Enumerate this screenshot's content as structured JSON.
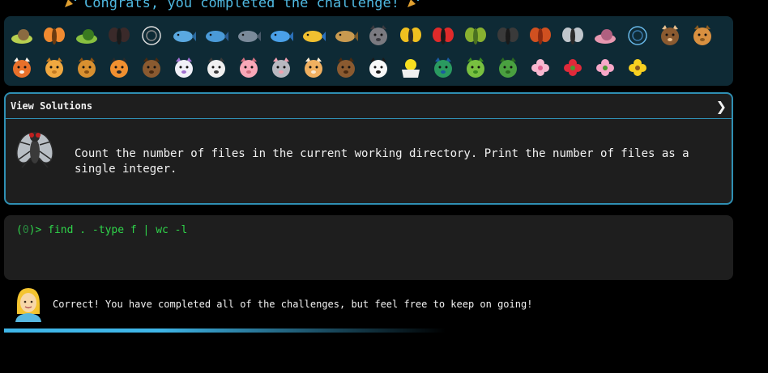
{
  "banner": {
    "text": "Congrats, you completed the challenge!",
    "icon_left": "party-popper-icon",
    "icon_right": "party-popper-icon"
  },
  "creatures": {
    "row1": [
      "snail",
      "butterfly",
      "caterpillar",
      "ant",
      "spider-web",
      "whale",
      "dolphin",
      "shark",
      "fish",
      "tropical-fish",
      "blowfish",
      "wolf",
      "bee",
      "ladybug",
      "cricket",
      "spider",
      "scorpion",
      "fly",
      "worm",
      "microbe",
      "monkey",
      "dog"
    ],
    "row2": [
      "fox",
      "cat",
      "lion",
      "tiger",
      "horse",
      "unicorn",
      "cow",
      "pig",
      "mouse",
      "hamster",
      "bear",
      "panda",
      "hatching-chick",
      "peacock",
      "frog",
      "dragon",
      "cherry-blossom",
      "rose",
      "rosette",
      "sunflower"
    ]
  },
  "solutions": {
    "title": "View Solutions",
    "chevron": "❯",
    "task_icon": "fly-icon",
    "task_text": "Count the number of files in the current working directory. Print the number of files as a single integer."
  },
  "terminal": {
    "prompt_open": "(",
    "prompt_num": "0",
    "prompt_close": ")>",
    "command": " find . -type f | wc -l"
  },
  "feedback": {
    "avatar": "woman-avatar-icon",
    "text": "Correct! You have completed all of the challenges, but feel free to keep on going!"
  },
  "progress": {
    "fraction": 1.0
  },
  "colors": {
    "background": "#000000",
    "panel_dark_teal": "#0e2a35",
    "panel_gray": "#1e1e1e",
    "accent_border": "#2f8fb3",
    "banner_blue": "#4fb8e0",
    "terminal_green": "#2fd44a",
    "progress_blue": "#3fb6e8"
  }
}
